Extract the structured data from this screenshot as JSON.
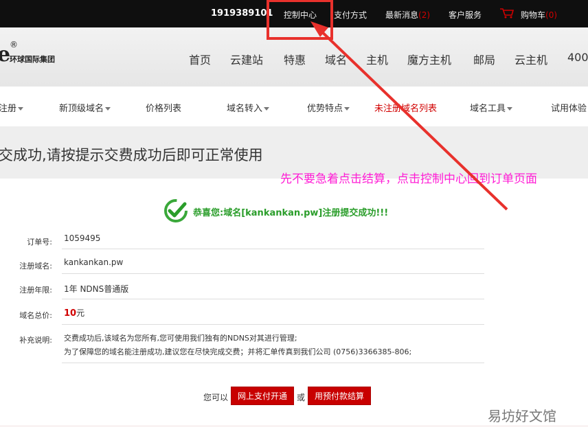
{
  "topbar": {
    "account": "1919389101",
    "links": [
      "控制中心",
      "支付方式",
      "最新消息",
      "客户服务",
      "购物车"
    ],
    "news_count": "(2)",
    "cart_count": "(0)"
  },
  "logo": {
    "mark": "e",
    "registered": "®",
    "name": "环球国际集团"
  },
  "main_nav": [
    "首页",
    "云建站",
    "特惠",
    "域名",
    "主机",
    "魔方主机",
    "邮局",
    "云主机",
    "400"
  ],
  "sub_nav": [
    "注册",
    "新顶级域名",
    "价格列表",
    "域名转入",
    "优势特点",
    "未注册域名列表",
    "域名工具",
    "试用体验"
  ],
  "banner": {
    "text": "交成功,请按提示交费成功后即可正常使用"
  },
  "annotation": "先不要急着点击结算，点击控制中心回到订单页面",
  "success_message": "恭喜您:域名[kankankan.pw]注册提交成功!!!",
  "order": {
    "order_no_label": "订单号:",
    "order_no": "1059495",
    "domain_label": "注册域名:",
    "domain": "kankankan.pw",
    "term_label": "注册年限:",
    "term": "1年 NDNS普通版",
    "price_label": "域名总价:",
    "price": "10",
    "price_unit": "元",
    "notes_label": "补充说明:",
    "notes_line1": "交费成功后,该域名为您所有,您可使用我们独有的NDNS对其进行管理;",
    "notes_line2": "为了保障您的域名能注册成功,建议您在尽快完成交费；并将汇单传真到我们公司 (0756)3366385-806;"
  },
  "actions": {
    "prefix": "您可以",
    "pay_online": "网上支付开通",
    "or": "或",
    "pay_prepaid": "用预付款结算"
  },
  "watermark": "易坊好文馆",
  "colors": {
    "accent_red": "#c80000",
    "annotation_pink": "#ff1dd5",
    "success_green": "#2a9d2a"
  }
}
